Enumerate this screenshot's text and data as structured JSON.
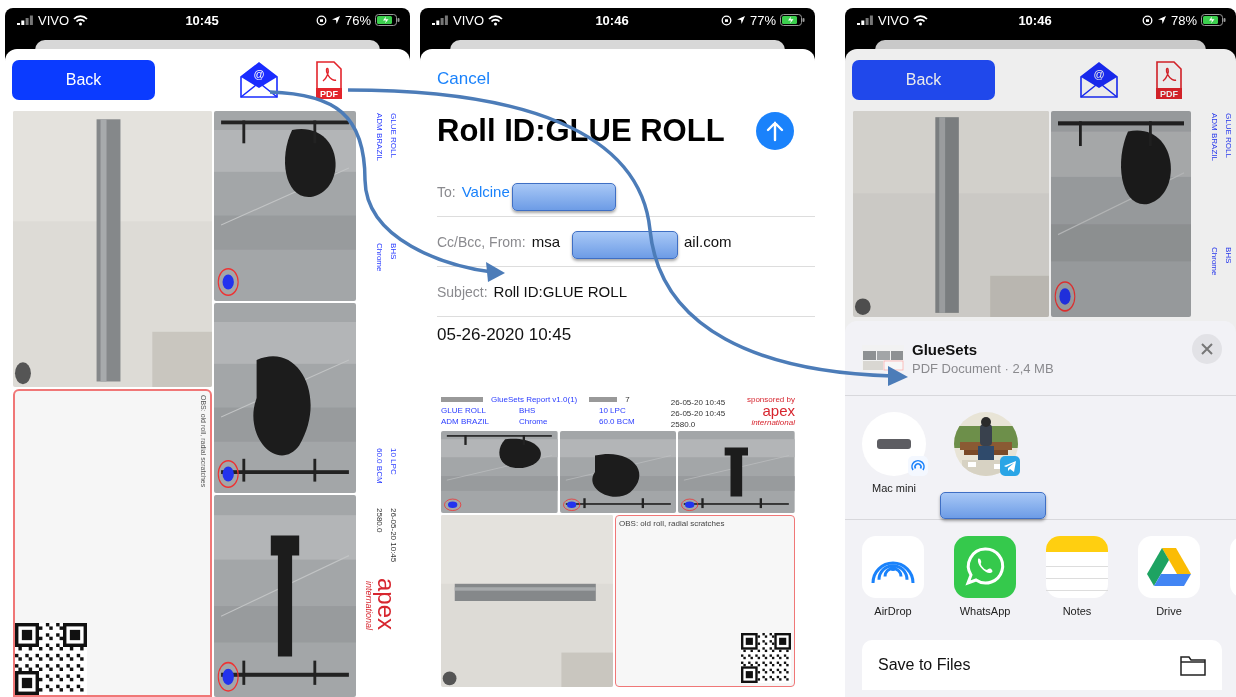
{
  "phones": [
    {
      "status": {
        "carrier": "VIVO",
        "time": "10:45",
        "battery": "76%"
      }
    },
    {
      "status": {
        "carrier": "VIVO",
        "time": "10:46",
        "battery": "77%"
      }
    },
    {
      "status": {
        "carrier": "VIVO",
        "time": "10:46",
        "battery": "78%"
      }
    }
  ],
  "report_screen": {
    "back_button": "Back",
    "mail_icon_label": "@",
    "pdf_icon_label": "PDF",
    "report": {
      "obs": "OBS: old roll, radial scratches",
      "labels": [
        [
          "GLUE ROLL",
          "ADM BRAZIL"
        ],
        [
          "BHS",
          "Chrome"
        ],
        [
          "10 LPC",
          "60.0 BCM"
        ],
        [
          "26-05-20 10:45",
          "2580.0"
        ]
      ],
      "logo": "apex",
      "logo_sub": "international"
    }
  },
  "mail_compose": {
    "cancel": "Cancel",
    "title": "Roll ID:GLUE ROLL",
    "to_label": "To:",
    "to_value": "Valcine",
    "from_label": "Cc/Bcc, From:",
    "from_value_start": "msa",
    "from_value_end": "ail.com",
    "subject_label": "Subject:",
    "subject_value": "Roll ID:GLUE ROLL",
    "body": "05-26-2020 10:45",
    "attachment": {
      "title": "GlueSets Report v1.0(1)",
      "count": "7",
      "sponsor": "sponsored by",
      "labels": [
        [
          "GLUE ROLL",
          "ADM BRAZIL"
        ],
        [
          "BHS",
          "Chrome"
        ],
        [
          "10 LPC",
          "60.0 BCM"
        ]
      ],
      "dates": [
        "26-05-20 10:45",
        "26-05-20 10:45",
        "2580.0"
      ],
      "obs": "OBS: old roll, radial scratches",
      "logo": "apex",
      "logo_sub": "international"
    }
  },
  "share_background": {
    "back_button": "Back",
    "mail_icon_label": "@",
    "pdf_icon_label": "PDF",
    "labels": [
      [
        "GLUE ROLL",
        "ADM BRAZIL"
      ],
      [
        "BHS",
        "Chrome"
      ]
    ]
  },
  "share_sheet": {
    "file_name": "GlueSets",
    "file_info": "PDF Document · 2,4 MB",
    "contacts": [
      {
        "kind": "device",
        "name": "Mac mini"
      },
      {
        "kind": "person"
      }
    ],
    "apps": [
      {
        "kind": "airdrop",
        "name": "AirDrop"
      },
      {
        "kind": "whatsapp",
        "name": "WhatsApp"
      },
      {
        "kind": "notes",
        "name": "Notes"
      },
      {
        "kind": "drive",
        "name": "Drive"
      },
      {
        "kind": "partial"
      }
    ],
    "actions": [
      {
        "label": "Save to Files"
      }
    ]
  }
}
